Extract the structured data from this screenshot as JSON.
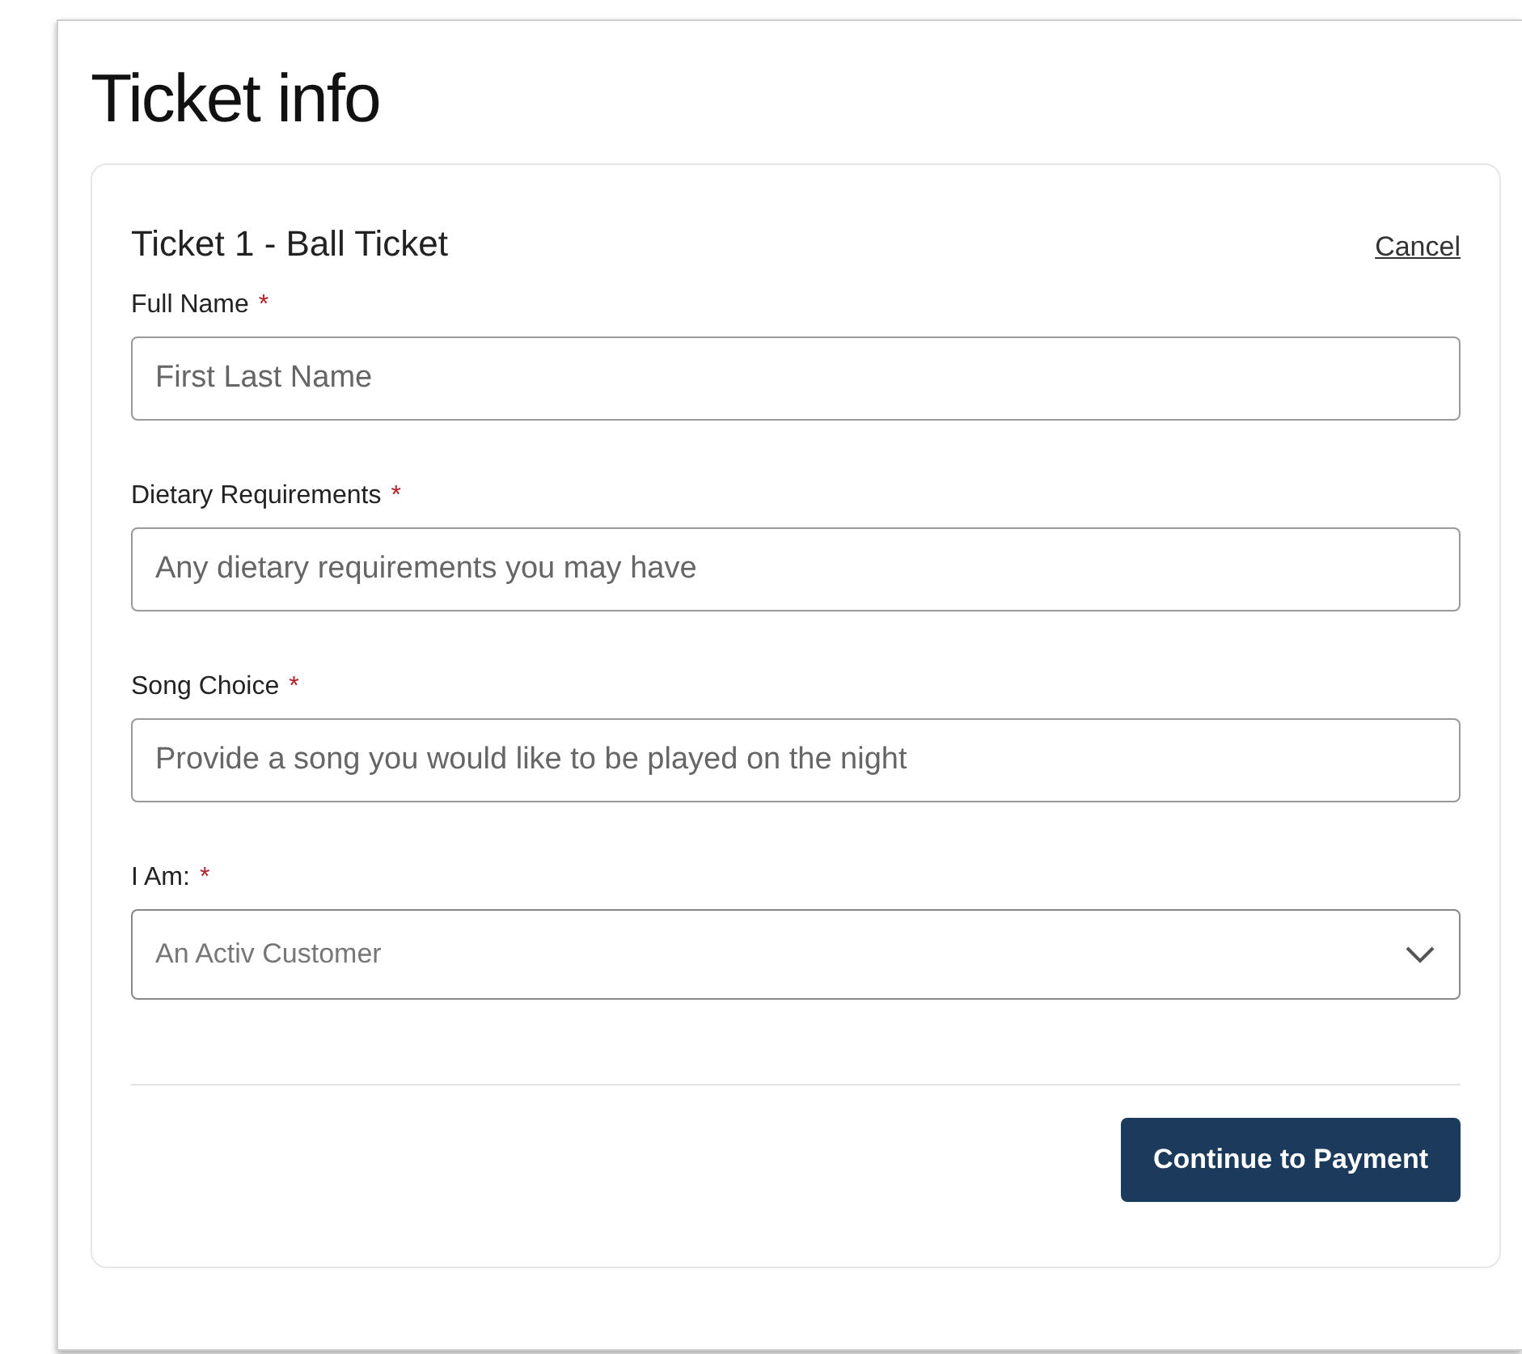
{
  "page": {
    "title": "Ticket info"
  },
  "ticket": {
    "title": "Ticket 1 - Ball Ticket",
    "cancel_link": "Cancel"
  },
  "fields": [
    {
      "kind": "text",
      "label": "Full Name",
      "required": true,
      "required_mark": "*",
      "placeholder": "First Last Name"
    },
    {
      "kind": "text",
      "label": "Dietary Requirements",
      "required": true,
      "required_mark": "*",
      "placeholder": "Any dietary requirements you may have"
    },
    {
      "kind": "text",
      "label": "Song Choice",
      "required": true,
      "required_mark": "*",
      "placeholder": "Provide a song you would like to be played on the night"
    },
    {
      "kind": "select",
      "label": "I Am:",
      "required": true,
      "required_mark": "*",
      "value": "An Activ Customer"
    }
  ],
  "submit_button": "Continue to Payment"
}
